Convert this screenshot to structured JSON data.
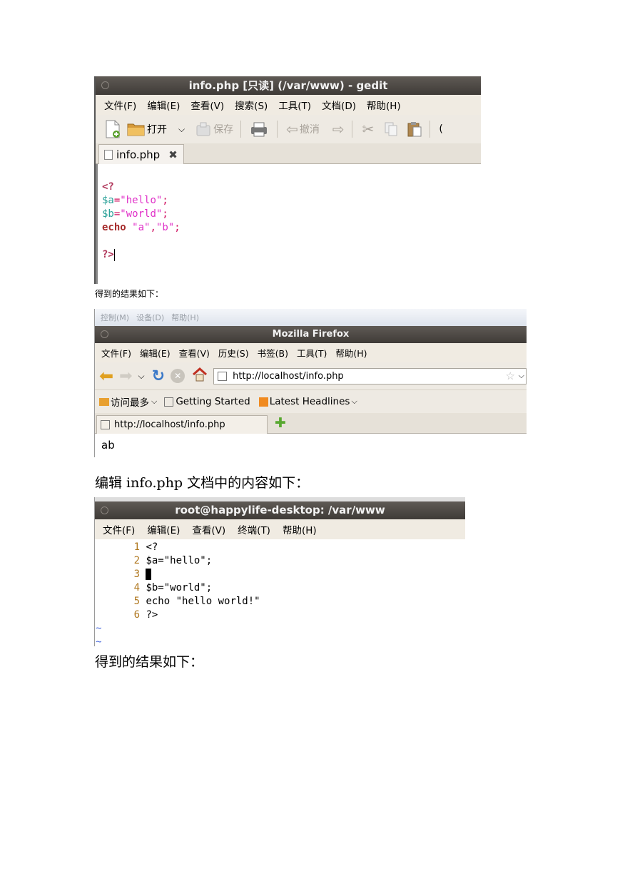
{
  "gedit": {
    "title": "info.php [只读] (/var/www) - gedit",
    "menu": [
      "文件(F)",
      "编辑(E)",
      "查看(V)",
      "搜索(S)",
      "工具(T)",
      "文档(D)",
      "帮助(H)"
    ],
    "toolbar": {
      "open_label": "打开",
      "save_label": "保存",
      "undo_label": "撤消"
    },
    "tab_label": "info.php",
    "code": {
      "l1": "<?",
      "l2_var": "$a",
      "l2_eq": "=",
      "l2_str": "\"hello\"",
      "l2_end": ";",
      "l3_var": "$b",
      "l3_eq": "=",
      "l3_str": "\"world\"",
      "l3_end": ";",
      "l4_kw": "echo",
      "l4_s1": "\"a\"",
      "l4_comma": ",",
      "l4_s2": "\"b\"",
      "l4_end": ";",
      "l6": "?>"
    }
  },
  "caption1": "得到的结果如下：",
  "firefox": {
    "host_menu": [
      "控制(M)",
      "设备(D)",
      "帮助(H)"
    ],
    "title": "Mozilla Firefox",
    "menu": [
      "文件(F)",
      "编辑(E)",
      "查看(V)",
      "历史(S)",
      "书签(B)",
      "工具(T)",
      "帮助(H)"
    ],
    "url": "http://localhost/info.php",
    "bookmarks": [
      "访问最多",
      "Getting Started",
      "Latest Headlines"
    ],
    "tab_label": "http://localhost/info.php",
    "content": "ab"
  },
  "caption2": "编辑 info.php 文档中的内容如下：",
  "terminal": {
    "title": "root@happylife-desktop: /var/www",
    "menu": [
      "文件(F)",
      "编辑(E)",
      "查看(V)",
      "终端(T)",
      "帮助(H)"
    ],
    "lines": [
      {
        "num": "1",
        "text": "<?"
      },
      {
        "num": "2",
        "text": "$a=\"hello\";"
      },
      {
        "num": "3",
        "text": ""
      },
      {
        "num": "4",
        "text": "$b=\"world\";"
      },
      {
        "num": "5",
        "text": "echo \"hello world!\""
      },
      {
        "num": "6",
        "text": "?>"
      }
    ],
    "tilde": "~"
  },
  "caption3": "得到的结果如下："
}
